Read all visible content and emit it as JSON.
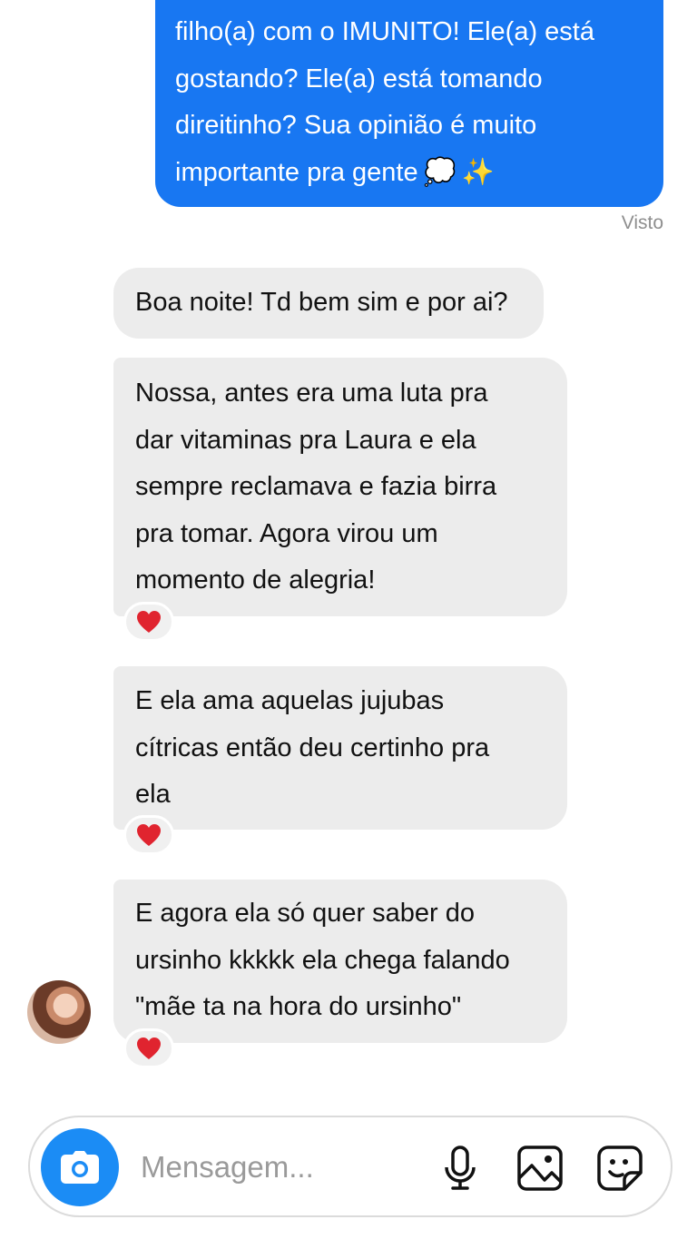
{
  "outgoing": {
    "lines": [
      "filho(a) com o IMUNITO! Ele(a) está",
      "gostando? Ele(a) está tomando",
      "direitinho? Sua opinião é muito",
      "importante pra gente"
    ],
    "emoji": [
      "💭",
      "✨"
    ],
    "status": "Visto"
  },
  "incoming": [
    {
      "lines": [
        "Boa noite! Td bem sim e por ai?"
      ]
    },
    {
      "lines": [
        "Nossa, antes era uma luta pra",
        "dar vitaminas pra Laura e ela",
        "sempre reclamava e fazia birra",
        "pra tomar. Agora virou um",
        "momento de alegria!"
      ],
      "reaction": "heart"
    },
    {
      "lines": [
        "E ela ama aquelas jujubas",
        "cítricas então deu certinho pra",
        "ela"
      ],
      "reaction": "heart"
    },
    {
      "lines": [
        "E agora ela só quer saber do",
        "ursinho kkkkk ela chega falando",
        "\"mãe ta na hora do ursinho\""
      ],
      "reaction": "heart"
    }
  ],
  "composer": {
    "placeholder": "Mensagem...",
    "icons": [
      "camera-icon",
      "microphone-icon",
      "image-icon",
      "sticker-icon"
    ]
  },
  "colors": {
    "outgoing_bubble": "#1877f2",
    "incoming_bubble": "#ececec",
    "camera_button": "#1b8cf5",
    "seen_text": "#8e8e8e"
  }
}
